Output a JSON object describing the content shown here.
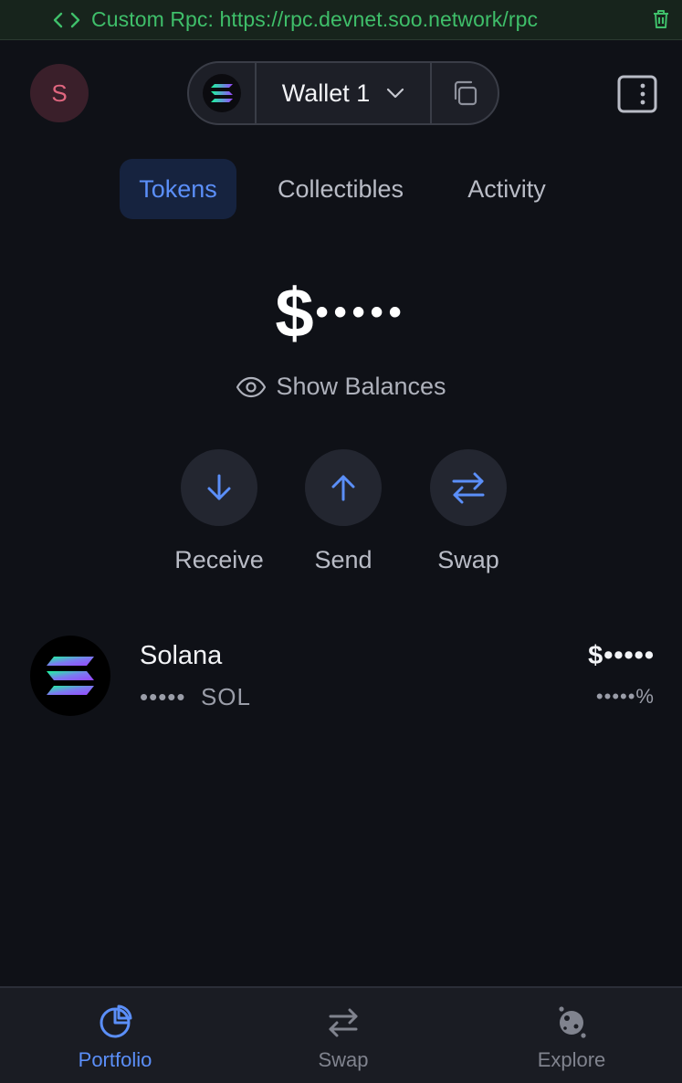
{
  "rpc_banner": {
    "text": "Custom Rpc: https://rpc.devnet.soo.network/rpc",
    "icon": "code-icon",
    "delete_icon": "trash-icon",
    "color": "#3fbf6a"
  },
  "header": {
    "avatar_initial": "S",
    "wallet_name": "Wallet 1",
    "wallet_logo_icon": "solana-logo-icon",
    "dropdown_icon": "chevron-down-icon",
    "copy_icon": "copy-icon",
    "sidepanel_icon": "side-panel-icon"
  },
  "tabs": [
    {
      "label": "Tokens",
      "active": true
    },
    {
      "label": "Collectibles",
      "active": false
    },
    {
      "label": "Activity",
      "active": false
    }
  ],
  "balance": {
    "currency": "$",
    "masked": "•••••"
  },
  "show_balances_label": "Show Balances",
  "actions": [
    {
      "label": "Receive",
      "icon": "arrow-down-icon"
    },
    {
      "label": "Send",
      "icon": "arrow-up-icon"
    },
    {
      "label": "Swap",
      "icon": "swap-arrows-icon"
    }
  ],
  "tokens": [
    {
      "name": "Solana",
      "amount_masked": "•••••",
      "symbol": "SOL",
      "value_masked": "$•••••",
      "change_masked": "•••••%"
    }
  ],
  "bottom_nav": [
    {
      "label": "Portfolio",
      "icon": "pie-chart-icon",
      "active": true
    },
    {
      "label": "Swap",
      "icon": "swap-arrows-icon",
      "active": false
    },
    {
      "label": "Explore",
      "icon": "planet-icon",
      "active": false
    }
  ],
  "colors": {
    "background": "#0f1117",
    "accent": "#5b8ff9",
    "active_tab_bg": "#16233f",
    "rpc_green": "#3fbf6a",
    "avatar_bg": "#3a1f2a",
    "avatar_text": "#e0667f"
  }
}
